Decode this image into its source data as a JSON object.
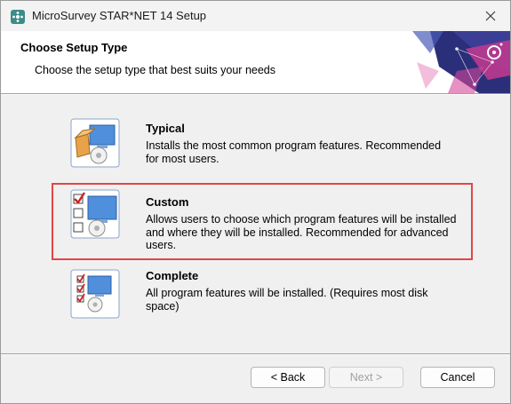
{
  "window": {
    "title": "MicroSurvey STAR*NET 14 Setup",
    "close_icon": "close-icon"
  },
  "header": {
    "title": "Choose Setup Type",
    "subtitle": "Choose the setup type that best suits your needs"
  },
  "options": [
    {
      "title": "Typical",
      "description": "Installs the most common program features. Recommended for most users.",
      "icon": "typical-setup-icon"
    },
    {
      "title": "Custom",
      "description": "Allows users to choose which program features will be installed and where they will be installed. Recommended for advanced users.",
      "icon": "custom-setup-icon"
    },
    {
      "title": "Complete",
      "description": "All program features will be installed.  (Requires most disk space)",
      "icon": "complete-setup-icon"
    }
  ],
  "buttons": {
    "back": "< Back",
    "next": "Next >",
    "cancel": "Cancel"
  },
  "colors": {
    "highlight_border": "#e04646",
    "banner_navy": "#2b2f7a",
    "banner_magenta": "#c43a8f",
    "icon_blue": "#4f8fdc"
  }
}
